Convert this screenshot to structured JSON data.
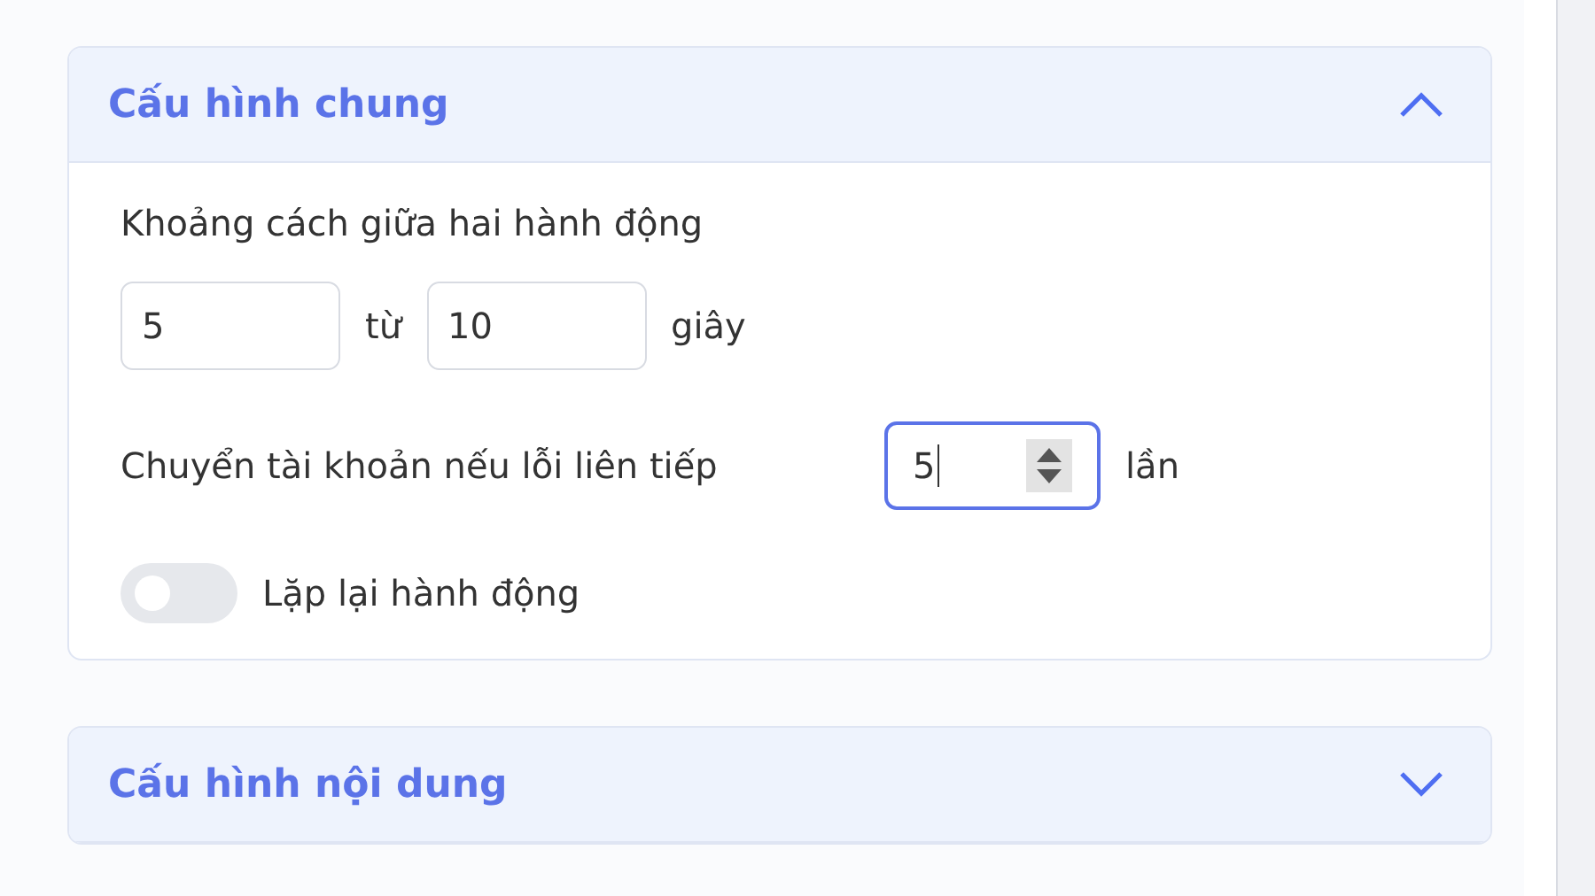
{
  "sections": [
    {
      "title": "Cấu hình chung",
      "expanded": true,
      "fields": [
        {
          "kind": "range",
          "label": "Khoảng cách giữa hai hành động",
          "from": "5",
          "connector": "từ",
          "to": "10",
          "unit": "giây"
        },
        {
          "kind": "number",
          "label": "Chuyển tài khoản nếu lỗi liên tiếp",
          "value": "5",
          "unit": "lần",
          "focused": true
        },
        {
          "kind": "toggle",
          "label": "Lặp lại hành động",
          "on": false
        }
      ]
    },
    {
      "title": "Cấu hình nội dung",
      "expanded": false
    }
  ]
}
